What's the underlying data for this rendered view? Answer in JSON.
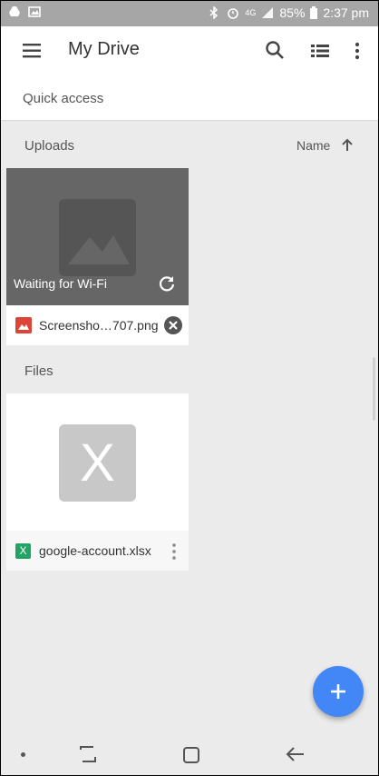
{
  "status_bar": {
    "battery": "85%",
    "time": "2:37 pm",
    "network": "4G"
  },
  "app_bar": {
    "title": "My Drive"
  },
  "quick_access": {
    "label": "Quick access"
  },
  "uploads": {
    "label": "Uploads",
    "sort_label": "Name",
    "item": {
      "status": "Waiting for Wi-Fi",
      "file_name": "Screensho…707.png"
    }
  },
  "files": {
    "label": "Files",
    "item": {
      "file_name": "google-account.xlsx",
      "thumb_letter": "X",
      "small_letter": "X"
    }
  },
  "colors": {
    "fab": "#4287f5",
    "xlsx_green": "#21a366",
    "image_red": "#db4437"
  },
  "icons": [
    "menu-icon",
    "search-icon",
    "list-view-icon",
    "more-vert-icon",
    "sort-up-arrow-icon",
    "refresh-icon",
    "cancel-icon",
    "image-icon",
    "xlsx-icon",
    "add-icon"
  ]
}
